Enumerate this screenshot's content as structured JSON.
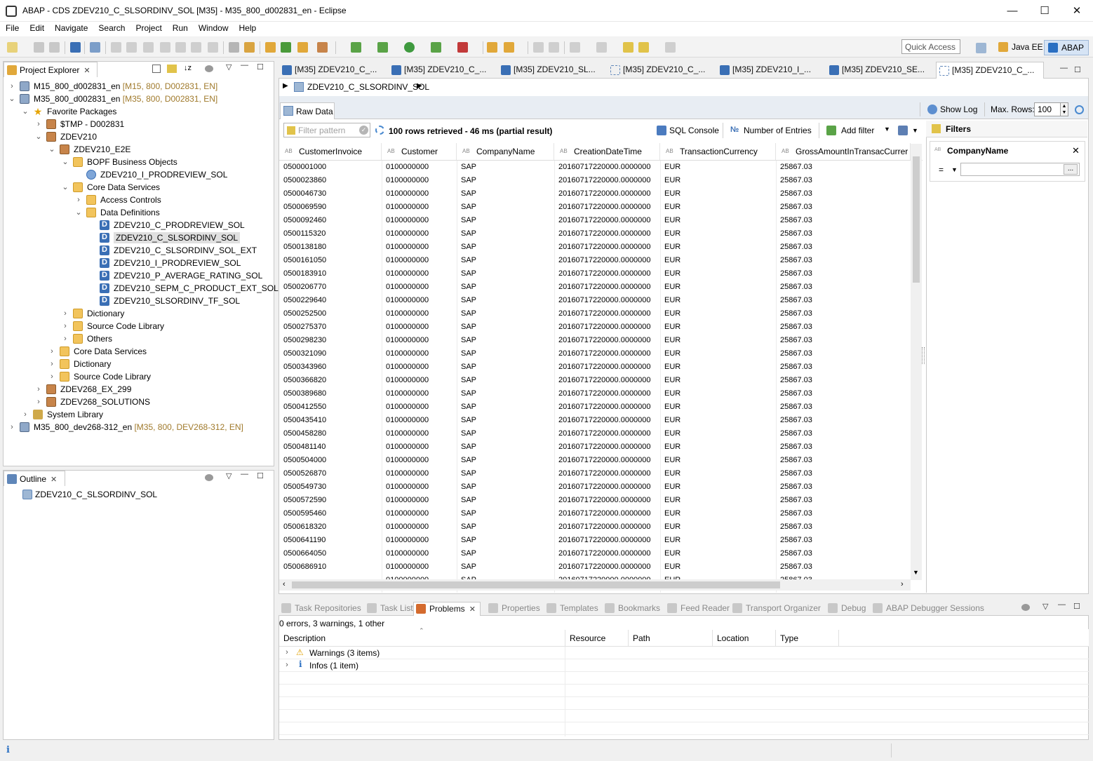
{
  "window": {
    "title": "ABAP - CDS ZDEV210_C_SLSORDINV_SOL [M35] - M35_800_d002831_en - Eclipse",
    "controls": {
      "minimize": "—",
      "maximize": "☐",
      "close": "✕"
    }
  },
  "menu": [
    "File",
    "Edit",
    "Navigate",
    "Search",
    "Project",
    "Run",
    "Window",
    "Help"
  ],
  "toolbar": {
    "quick_access": "Quick Access",
    "perspectives": [
      "Java EE",
      "ABAP"
    ]
  },
  "project_explorer": {
    "title": "Project Explorer",
    "tree": [
      {
        "depth": 0,
        "expand": "›",
        "icon": "project",
        "label": "M15_800_d002831_en",
        "deco": " [M15, 800, D002831, EN]"
      },
      {
        "depth": 0,
        "expand": "⌄",
        "icon": "project",
        "label": "M35_800_d002831_en",
        "deco": " [M35, 800, D002831, EN]"
      },
      {
        "depth": 1,
        "expand": "⌄",
        "icon": "star",
        "label": "Favorite Packages",
        "deco": ""
      },
      {
        "depth": 2,
        "expand": "›",
        "icon": "pkg",
        "label": "$TMP - D002831",
        "deco": ""
      },
      {
        "depth": 2,
        "expand": "⌄",
        "icon": "pkg",
        "label": "ZDEV210",
        "deco": ""
      },
      {
        "depth": 3,
        "expand": "⌄",
        "icon": "pkg",
        "label": "ZDEV210_E2E",
        "deco": ""
      },
      {
        "depth": 4,
        "expand": "⌄",
        "icon": "folder",
        "label": "BOPF Business Objects",
        "deco": ""
      },
      {
        "depth": 5,
        "expand": "",
        "icon": "bo",
        "label": "ZDEV210_I_PRODREVIEW_SOL",
        "deco": ""
      },
      {
        "depth": 4,
        "expand": "⌄",
        "icon": "folder",
        "label": "Core Data Services",
        "deco": ""
      },
      {
        "depth": 5,
        "expand": "›",
        "icon": "folder",
        "label": "Access Controls",
        "deco": ""
      },
      {
        "depth": 5,
        "expand": "⌄",
        "icon": "folder",
        "label": "Data Definitions",
        "deco": ""
      },
      {
        "depth": 6,
        "expand": "",
        "icon": "ddl",
        "label": "ZDEV210_C_PRODREVIEW_SOL",
        "deco": ""
      },
      {
        "depth": 6,
        "expand": "",
        "icon": "ddl",
        "label": "ZDEV210_C_SLSORDINV_SOL",
        "deco": "",
        "selected": true
      },
      {
        "depth": 6,
        "expand": "",
        "icon": "ddl",
        "label": "ZDEV210_C_SLSORDINV_SOL_EXT",
        "deco": ""
      },
      {
        "depth": 6,
        "expand": "",
        "icon": "ddl",
        "label": "ZDEV210_I_PRODREVIEW_SOL",
        "deco": ""
      },
      {
        "depth": 6,
        "expand": "",
        "icon": "ddl",
        "label": "ZDEV210_P_AVERAGE_RATING_SOL",
        "deco": ""
      },
      {
        "depth": 6,
        "expand": "",
        "icon": "ddl",
        "label": "ZDEV210_SEPM_C_PRODUCT_EXT_SOL",
        "deco": ""
      },
      {
        "depth": 6,
        "expand": "",
        "icon": "ddl",
        "label": "ZDEV210_SLSORDINV_TF_SOL",
        "deco": ""
      },
      {
        "depth": 4,
        "expand": "›",
        "icon": "folder",
        "label": "Dictionary",
        "deco": ""
      },
      {
        "depth": 4,
        "expand": "›",
        "icon": "folder",
        "label": "Source Code Library",
        "deco": ""
      },
      {
        "depth": 4,
        "expand": "›",
        "icon": "folder",
        "label": "Others",
        "deco": ""
      },
      {
        "depth": 3,
        "expand": "›",
        "icon": "folder",
        "label": "Core Data Services",
        "deco": ""
      },
      {
        "depth": 3,
        "expand": "›",
        "icon": "folder",
        "label": "Dictionary",
        "deco": ""
      },
      {
        "depth": 3,
        "expand": "›",
        "icon": "folder",
        "label": "Source Code Library",
        "deco": ""
      },
      {
        "depth": 2,
        "expand": "›",
        "icon": "pkg",
        "label": "ZDEV268_EX_299",
        "deco": ""
      },
      {
        "depth": 2,
        "expand": "›",
        "icon": "pkg",
        "label": "ZDEV268_SOLUTIONS",
        "deco": ""
      },
      {
        "depth": 1,
        "expand": "›",
        "icon": "lib",
        "label": "System Library",
        "deco": ""
      },
      {
        "depth": 0,
        "expand": "›",
        "icon": "project",
        "label": "M35_800_dev268-312_en",
        "deco": " [M35, 800, DEV268-312, EN]"
      }
    ]
  },
  "outline": {
    "title": "Outline",
    "item": "ZDEV210_C_SLSORDINV_SOL"
  },
  "editor": {
    "tabs": [
      "[M35] ZDEV210_C_...",
      "[M35] ZDEV210_C_...",
      "[M35] ZDEV210_SL...",
      "[M35] ZDEV210_C_...",
      "[M35] ZDEV210_I_...",
      "[M35] ZDEV210_SE...",
      "[M35] ZDEV210_C_..."
    ],
    "breadcrumb": "ZDEV210_C_SLSORDINV_SOL",
    "subtab": "Raw Data",
    "show_log": "Show Log",
    "max_rows_label": "Max. Rows:",
    "max_rows_value": "100",
    "filter_placeholder": "Filter pattern",
    "status": "100 rows retrieved - 46 ms (partial result)",
    "sql_console": "SQL Console",
    "number_of_entries": "Number of Entries",
    "add_filter": "Add filter",
    "columns": [
      "CustomerInvoice",
      "Customer",
      "CompanyName",
      "CreationDateTime",
      "TransactionCurrency",
      "GrossAmountInTransacCurrer"
    ],
    "invoices": [
      "0500001000",
      "0500023860",
      "0500046730",
      "0500069590",
      "0500092460",
      "0500115320",
      "0500138180",
      "0500161050",
      "0500183910",
      "0500206770",
      "0500229640",
      "0500252500",
      "0500275370",
      "0500298230",
      "0500321090",
      "0500343960",
      "0500366820",
      "0500389680",
      "0500412550",
      "0500435410",
      "0500458280",
      "0500481140",
      "0500504000",
      "0500526870",
      "0500549730",
      "0500572590",
      "0500595460",
      "0500618320",
      "0500641190",
      "0500664050",
      "0500686910"
    ],
    "row_values": {
      "customer": "0100000000",
      "company": "SAP",
      "created": "20160717220000.0000000",
      "currency": "EUR",
      "gross": "25867.03"
    }
  },
  "filters": {
    "title": "Filters",
    "field": "CompanyName",
    "operator": "=",
    "value": "",
    "browse": "..."
  },
  "bottom": {
    "tabs": [
      "Task Repositories",
      "Task List",
      "Problems",
      "Properties",
      "Templates",
      "Bookmarks",
      "Feed Reader",
      "Transport Organizer",
      "Debug",
      "ABAP Debugger Sessions"
    ],
    "summary": "0 errors, 3 warnings, 1 other",
    "columns": [
      "Description",
      "Resource",
      "Path",
      "Location",
      "Type"
    ],
    "rows": [
      {
        "icon": "⚠",
        "label": "Warnings (3 items)"
      },
      {
        "icon": "i",
        "label": "Infos (1 item)"
      }
    ]
  },
  "statusbar": {
    "icon": "i"
  },
  "colors": {
    "accent": "#3a6fb5",
    "selection": "#e0e0e0",
    "folder": "#f2c45c"
  }
}
